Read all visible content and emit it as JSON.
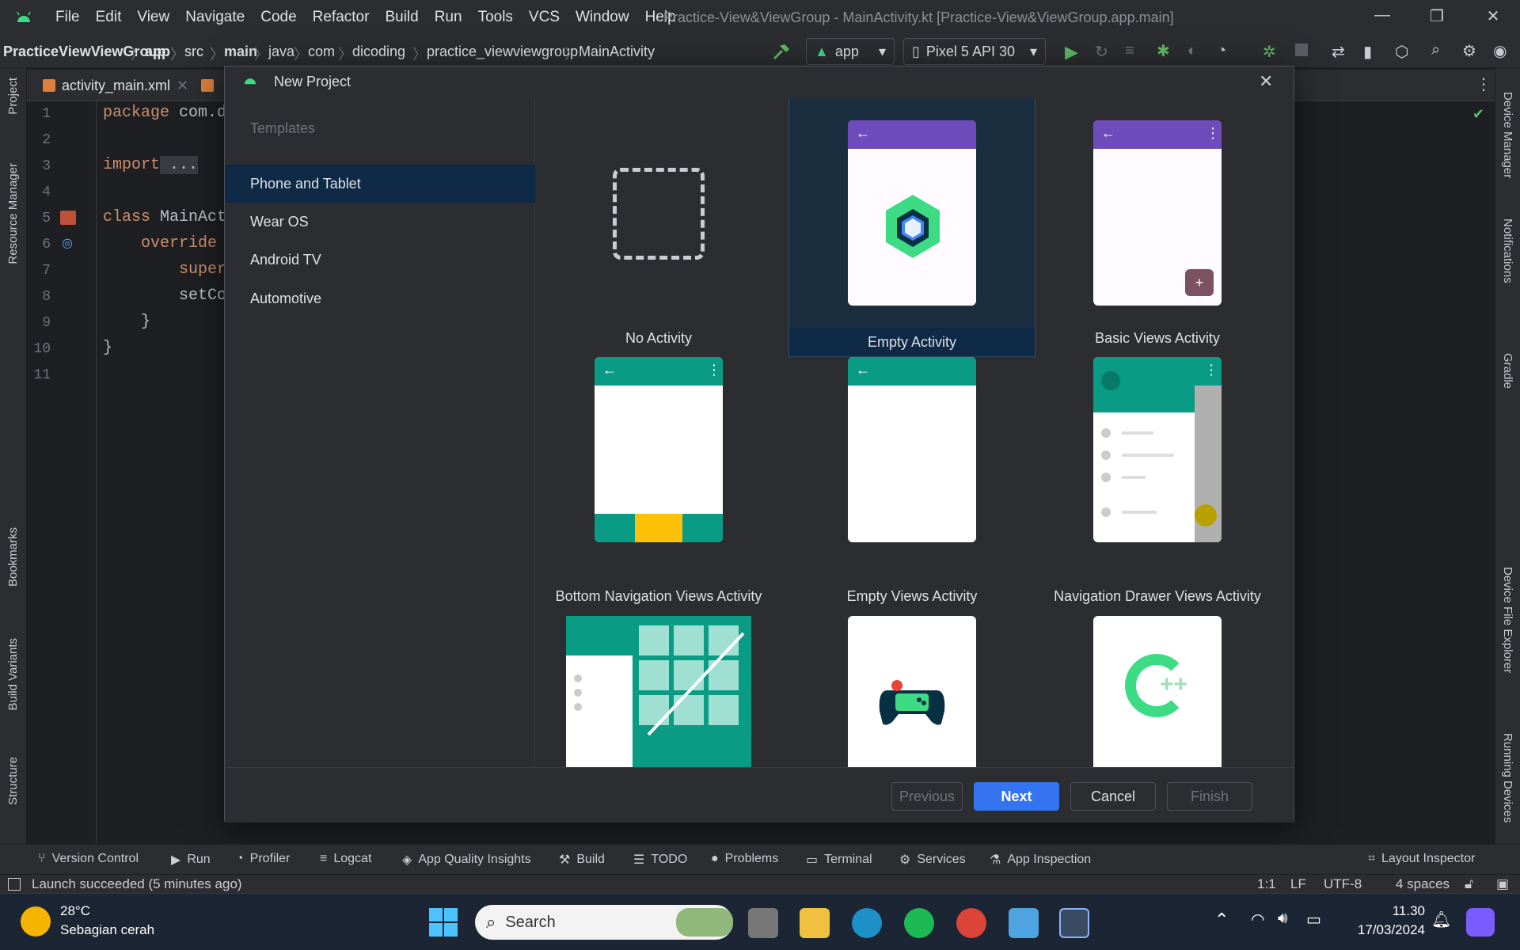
{
  "window": {
    "title": "Practice-View&ViewGroup - MainActivity.kt [Practice-View&ViewGroup.app.main]",
    "menu": [
      "File",
      "Edit",
      "View",
      "Navigate",
      "Code",
      "Refactor",
      "Build",
      "Run",
      "Tools",
      "VCS",
      "Window",
      "Help"
    ]
  },
  "breadcrumb": [
    "PracticeViewViewGroup",
    "app",
    "src",
    "main",
    "java",
    "com",
    "dicoding",
    "practice_viewviewgroup",
    "MainActivity"
  ],
  "run_config": {
    "module": "app",
    "device": "Pixel 5 API 30"
  },
  "left_tools": [
    "Project",
    "Resource Manager",
    "Bookmarks",
    "Build Variants",
    "Structure"
  ],
  "right_tools": [
    "Device Manager",
    "Notifications",
    "Gradle",
    "Device File Explorer",
    "Running Devices"
  ],
  "editor": {
    "tabs": [
      "activity_main.xml"
    ],
    "lines": [
      "1",
      "2",
      "3",
      "4",
      "5",
      "6",
      "7",
      "8",
      "9",
      "10",
      "11"
    ],
    "code": {
      "l1_kw": "package",
      "l1_rest": " com.d",
      "l3_kw": "import",
      "l3_rest": " ...",
      "l6_kw": "class",
      "l6_rest": " MainAct",
      "l7_kw": "override",
      "l8_kw": "super",
      "l9_fn": "setCo",
      "l10": "}",
      "l11": "}"
    }
  },
  "dialog": {
    "title": "New Project",
    "sidebar_header": "Templates",
    "categories": [
      "Phone and Tablet",
      "Wear OS",
      "Android TV",
      "Automotive"
    ],
    "selected_category": "Phone and Tablet",
    "templates": [
      "No Activity",
      "Empty Activity",
      "Basic Views Activity",
      "Bottom Navigation Views Activity",
      "Empty Views Activity",
      "Navigation Drawer Views Activity"
    ],
    "selected_template": "Empty Activity",
    "buttons": {
      "previous": "Previous",
      "next": "Next",
      "cancel": "Cancel",
      "finish": "Finish"
    },
    "cpp_label": "++"
  },
  "tool_windows": [
    "Version Control",
    "Run",
    "Profiler",
    "Logcat",
    "App Quality Insights",
    "Build",
    "TODO",
    "Problems",
    "Terminal",
    "Services",
    "App Inspection",
    "Layout Inspector"
  ],
  "status": {
    "message": "Launch succeeded (5 minutes ago)",
    "position": "1:1",
    "line_sep": "LF",
    "encoding": "UTF-8",
    "indent": "4 spaces"
  },
  "taskbar": {
    "weather_temp": "28°C",
    "weather_desc": "Sebagian cerah",
    "search_label": "Search",
    "time": "11.30",
    "date": "17/03/2024"
  },
  "colors": {
    "accent": "#3574f0",
    "android_green": "#3ddc84",
    "purple_appbar": "#6f4cbb",
    "teal_appbar": "#0a9b85",
    "amber": "#ffc107"
  }
}
